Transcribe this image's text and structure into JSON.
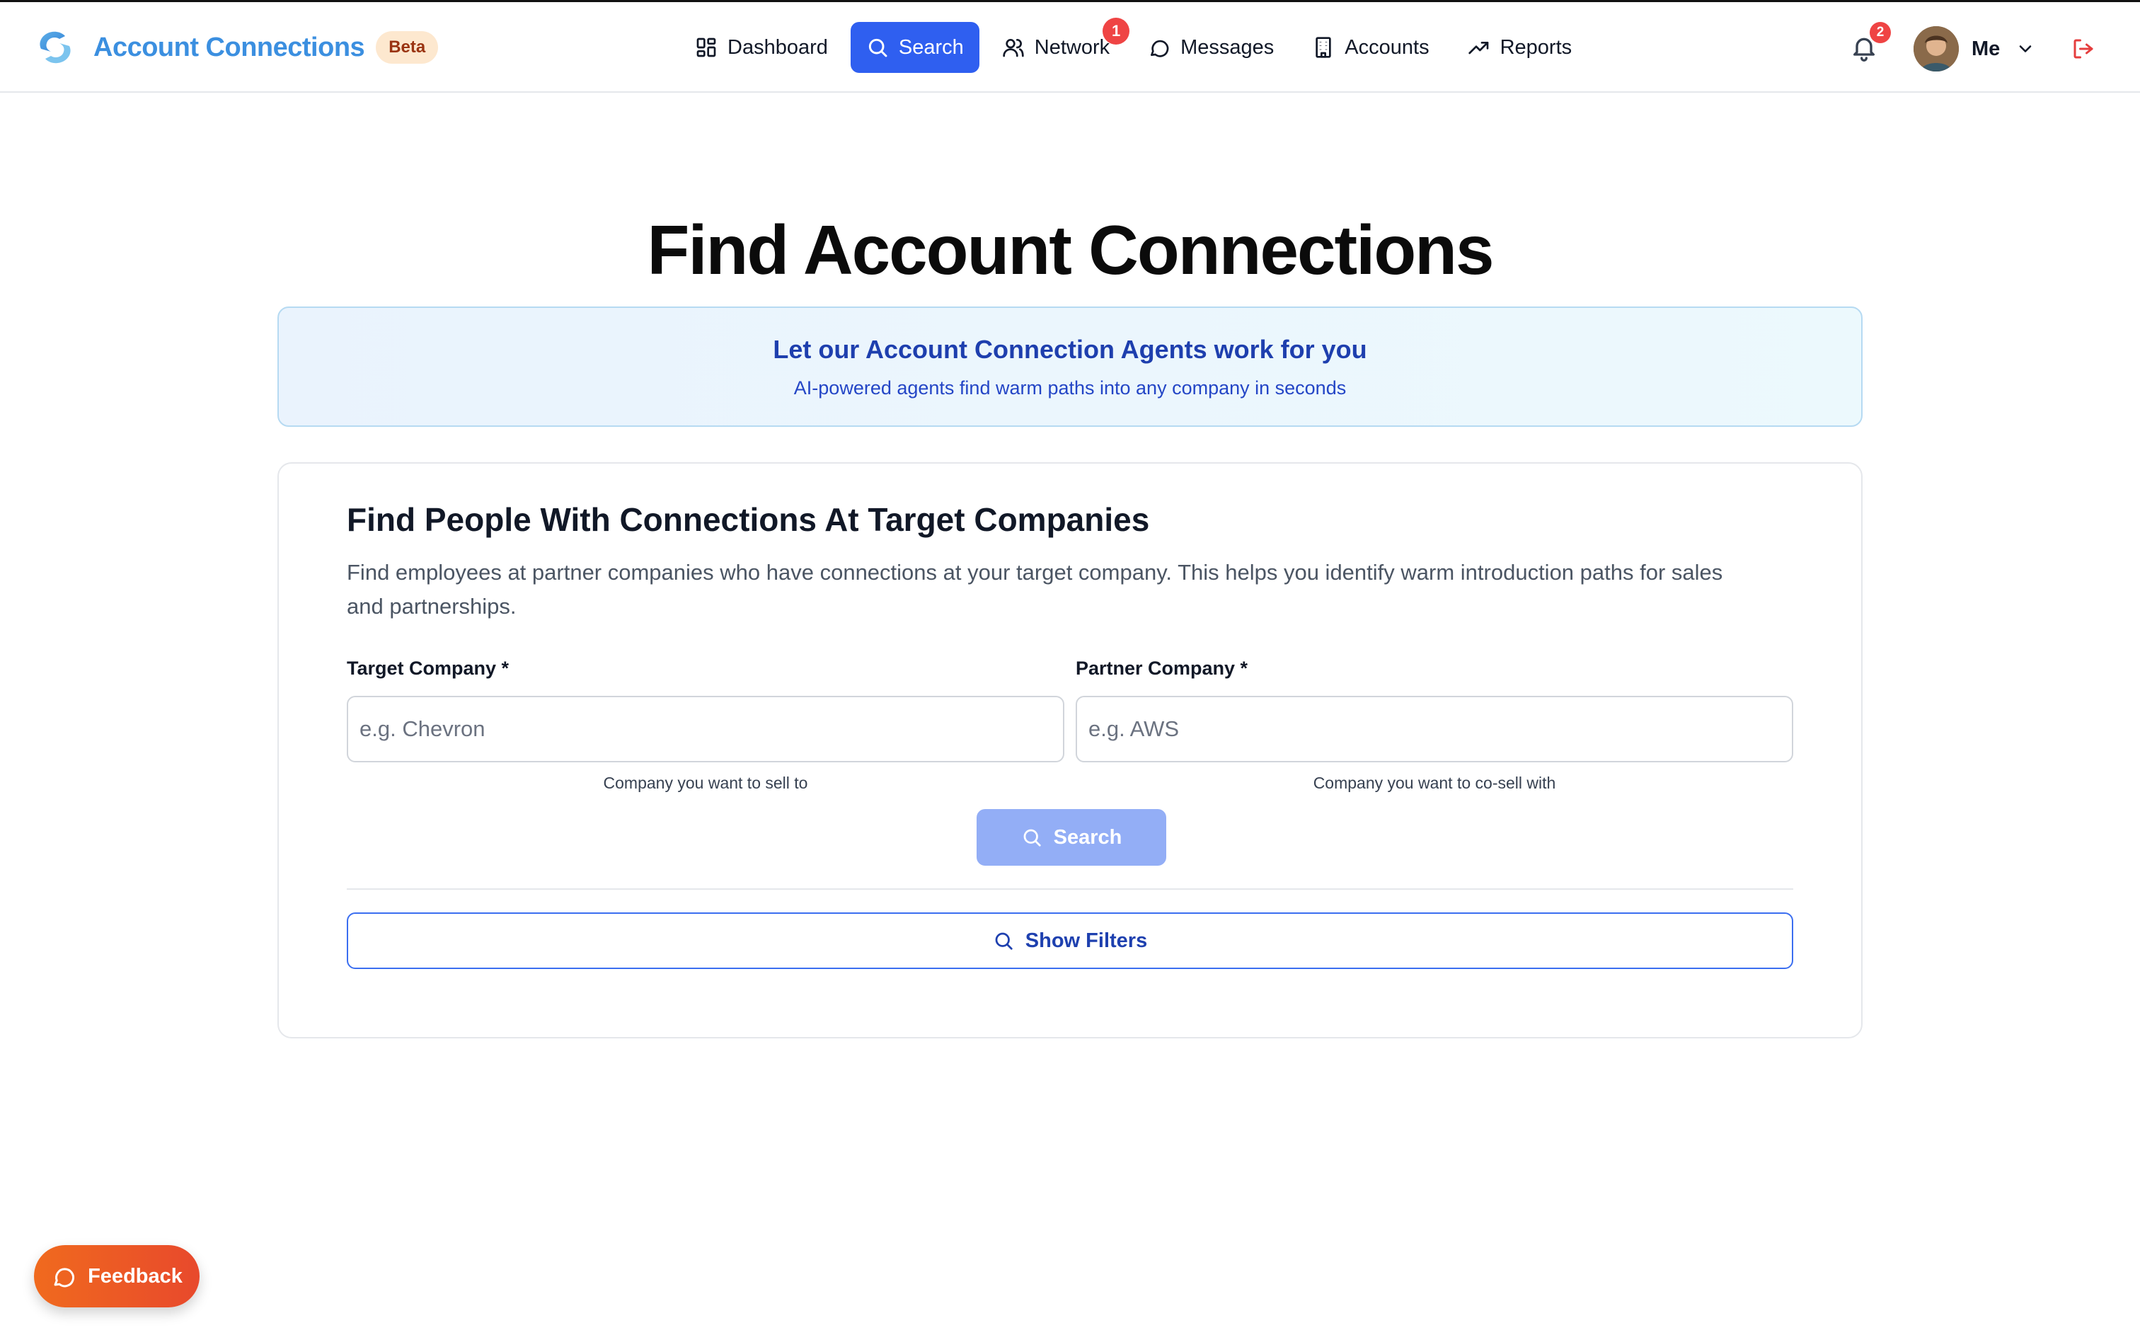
{
  "header": {
    "brand_name": "Account Connections",
    "brand_badge": "Beta",
    "nav": [
      {
        "label": "Dashboard",
        "icon": "dashboard-grid-icon",
        "active": false
      },
      {
        "label": "Search",
        "icon": "search-icon",
        "active": true
      },
      {
        "label": "Network",
        "icon": "users-icon",
        "active": false,
        "badge": "1"
      },
      {
        "label": "Messages",
        "icon": "message-bubble-icon",
        "active": false
      },
      {
        "label": "Accounts",
        "icon": "building-icon",
        "active": false
      },
      {
        "label": "Reports",
        "icon": "trending-up-icon",
        "active": false
      }
    ],
    "notifications_badge": "2",
    "user_name": "Me"
  },
  "main": {
    "title": "Find Account Connections",
    "banner": {
      "title": "Let our Account Connection Agents work for you",
      "subtitle": "AI-powered agents find warm paths into any company in seconds"
    },
    "card": {
      "title": "Find People With Connections At Target Companies",
      "description": "Find employees at partner companies who have connections at your target company. This helps you identify warm introduction paths for sales and partnerships.",
      "target": {
        "label": "Target Company *",
        "placeholder": "e.g. Chevron",
        "value": "",
        "help": "Company you want to sell to"
      },
      "partner": {
        "label": "Partner Company *",
        "placeholder": "e.g. AWS",
        "value": "",
        "help": "Company you want to co-sell with"
      },
      "search_label": "Search",
      "filters_label": "Show Filters"
    }
  },
  "feedback_label": "Feedback",
  "colors": {
    "primary": "#2f5ff0",
    "brand_text": "#3b8fe0",
    "badge_red": "#ef4444",
    "feedback_orange": "#f06a1e"
  }
}
